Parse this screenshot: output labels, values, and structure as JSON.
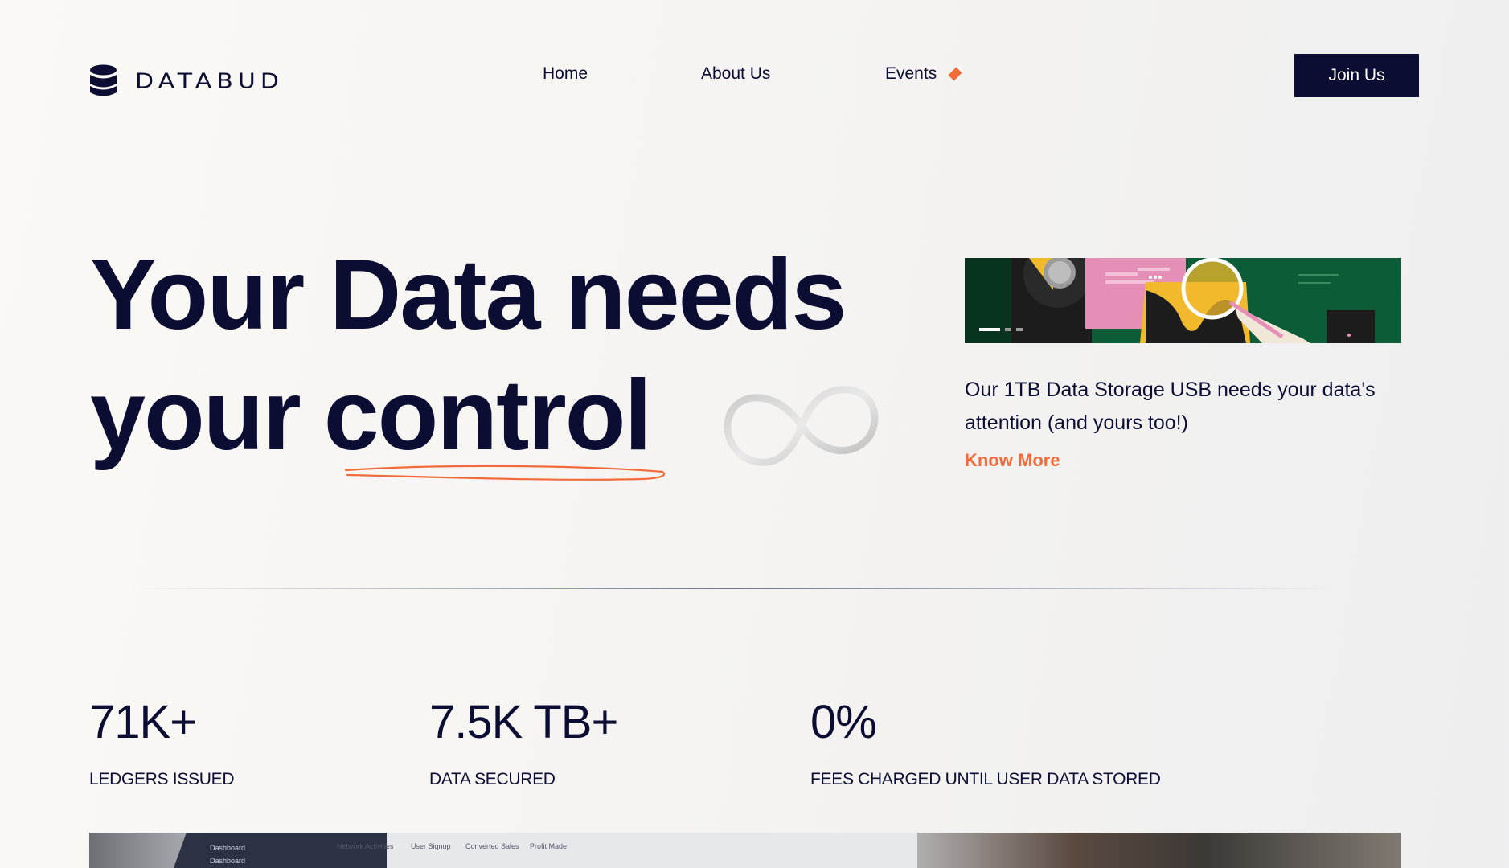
{
  "brand": {
    "name": "DATABUD",
    "logo_icon": "database-stack-icon"
  },
  "nav": {
    "items": [
      {
        "label": "Home"
      },
      {
        "label": "About Us"
      },
      {
        "label": "Events"
      }
    ],
    "cta_label": "Join Us"
  },
  "hero": {
    "line1": "Your Data needs",
    "line2_word1": "your",
    "line2_word2": "control",
    "decoration_icon": "infinity-icon"
  },
  "promo": {
    "description": "Our 1TB Data Storage USB needs your data's attention (and yours too!)",
    "link_label": "Know More"
  },
  "stats": [
    {
      "value": "71K+",
      "label": "LEDGERS ISSUED"
    },
    {
      "value": "7.5K TB+",
      "label": "DATA SECURED"
    },
    {
      "value": "0%",
      "label": "FEES CHARGED UNTIL USER DATA STORED"
    }
  ],
  "bottom_image": {
    "tabs": [
      "Network Activities",
      "User Signup",
      "Converted Sales",
      "Profit Made"
    ],
    "sidebar": [
      "Dashboard",
      "Dashboard"
    ]
  },
  "colors": {
    "primary": "#0b0d33",
    "accent": "#f26b3a",
    "background": "#f6f5f2"
  }
}
